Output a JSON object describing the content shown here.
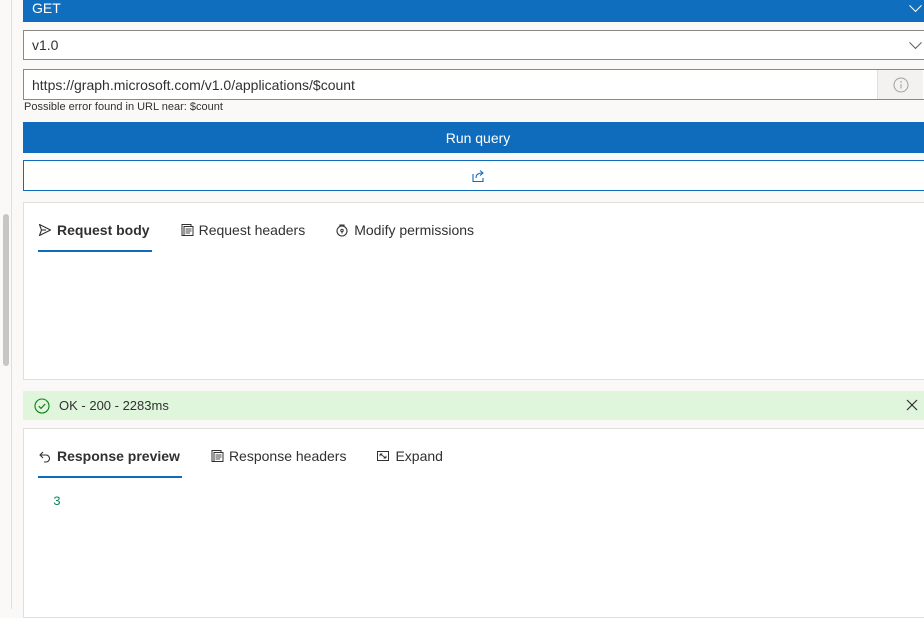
{
  "query": {
    "method": "GET",
    "version": "v1.0",
    "url": "https://graph.microsoft.com/v1.0/applications/$count",
    "url_error": "Possible error found in URL near: $count",
    "run_label": "Run query"
  },
  "request_tabs": [
    {
      "label": "Request body",
      "icon": "send-icon",
      "active": true
    },
    {
      "label": "Request headers",
      "icon": "document-icon",
      "active": false
    },
    {
      "label": "Modify permissions",
      "icon": "permissions-icon",
      "active": false
    }
  ],
  "status": {
    "text": "OK - 200 - 2283ms",
    "color": "#dff6dd"
  },
  "response_tabs": [
    {
      "label": "Response preview",
      "icon": "undo-arrow-icon",
      "active": true
    },
    {
      "label": "Response headers",
      "icon": "document-icon",
      "active": false
    },
    {
      "label": "Expand",
      "icon": "expand-icon",
      "active": false
    }
  ],
  "response": {
    "body": "3"
  },
  "colors": {
    "accent": "#0f6cbd",
    "success_bg": "#dff6dd",
    "json_number": "#098658"
  }
}
